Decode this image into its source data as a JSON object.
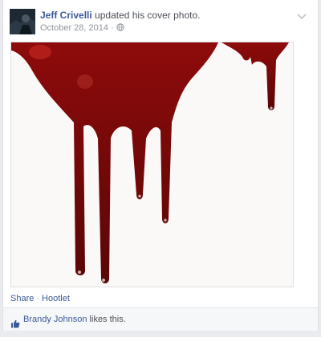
{
  "post": {
    "author": "Jeff Crivelli",
    "action": "updated his cover photo.",
    "date": "October 28, 2014",
    "separator": "·"
  },
  "icons": {
    "audience": "globe-icon",
    "menu": "chevron-down-icon",
    "like": "thumbs-up-icon"
  },
  "links": {
    "share": "Share",
    "dot": "·",
    "hootlet": "Hootlet"
  },
  "likes": {
    "name": "Brandy Johnson",
    "suffix": " likes this."
  },
  "colors": {
    "link": "#3b5998",
    "blood": "#7a0a0a"
  }
}
